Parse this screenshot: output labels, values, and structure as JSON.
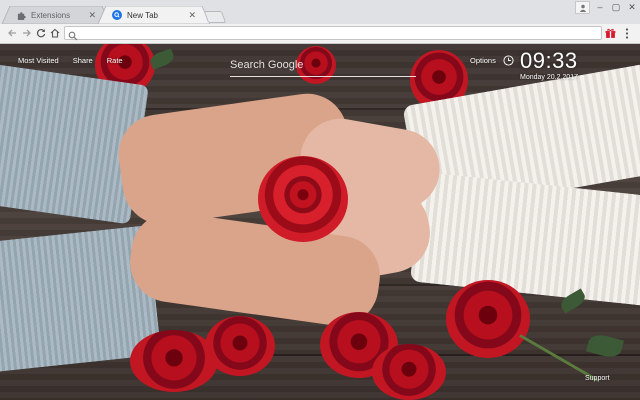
{
  "browser": {
    "tabs": [
      {
        "label": "Extensions",
        "icon": "puzzle-icon",
        "active": false
      },
      {
        "label": "New Tab",
        "icon": "new-tab-favicon",
        "active": true
      }
    ],
    "omnibox": {
      "value": "",
      "placeholder": ""
    }
  },
  "page": {
    "nav": {
      "most_visited": "Most Visited",
      "share": "Share",
      "rate": "Rate"
    },
    "search": {
      "placeholder": "Search Google"
    },
    "options": "Options",
    "clock": {
      "time": "09:33",
      "date": "Monday 20.2.2017"
    },
    "support": "Support",
    "background": {
      "description_colors": {
        "rose": "#c1121f",
        "wood": "#3d3431",
        "left_sleeve": "#9fb1bd",
        "right_sleeve": "#eeeae3"
      }
    }
  }
}
